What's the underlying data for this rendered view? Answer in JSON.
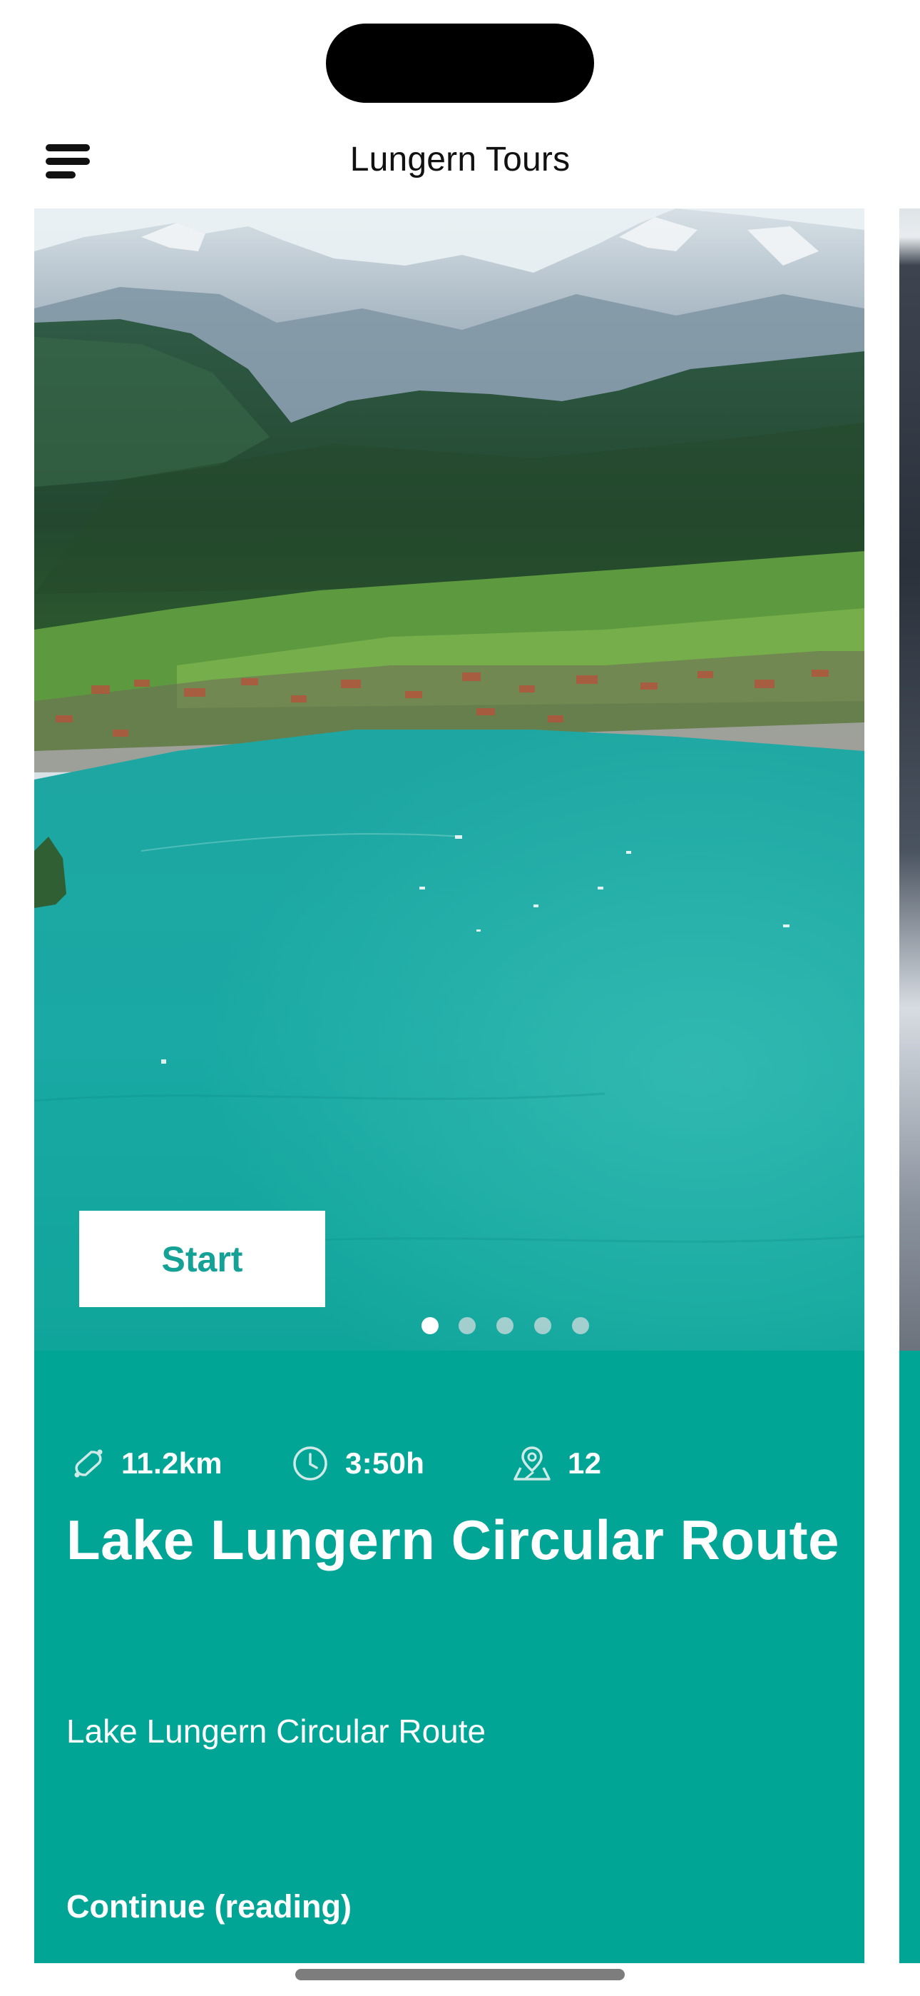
{
  "header": {
    "title": "Lungern Tours"
  },
  "tour_card": {
    "start_label": "Start",
    "carousel": {
      "count": 5,
      "active_index": 0
    },
    "stats": {
      "distance": "11.2km",
      "duration": "3:50h",
      "stops": "12"
    },
    "title": "Lake Lungern Circular Route",
    "description": "Lake Lungern Circular Route",
    "continue_label": "Continue (reading)"
  },
  "icons": {
    "menu": "menu-icon",
    "distance": "route-loop-icon",
    "duration": "clock-icon",
    "stops": "map-pin-icon"
  },
  "colors": {
    "accent": "#00a596",
    "start_text": "#16a196",
    "header_text": "#111111"
  }
}
